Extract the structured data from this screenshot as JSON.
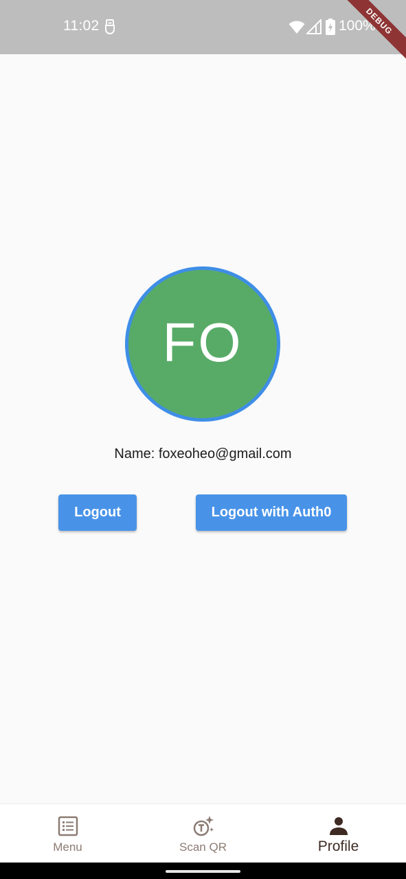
{
  "status_bar": {
    "time": "11:02",
    "battery": "100%",
    "icons": [
      "usb-icon",
      "wifi-icon",
      "signal-icon",
      "battery-icon"
    ]
  },
  "debug_banner": "DEBUG",
  "profile": {
    "initials": "FO",
    "name_text": "Name: foxeoheo@gmail.com",
    "avatar_color": "#58ab67",
    "avatar_border_color": "#3f8ee6"
  },
  "buttons": {
    "logout": "Logout",
    "logout_auth0": "Logout with Auth0",
    "color": "#4893e8"
  },
  "bottom_nav": {
    "items": [
      {
        "label": "Menu",
        "icon": "menu-list-icon",
        "selected": false
      },
      {
        "label": "Scan QR",
        "icon": "scan-qr-icon",
        "selected": false
      },
      {
        "label": "Profile",
        "icon": "person-icon",
        "selected": true
      }
    ]
  }
}
